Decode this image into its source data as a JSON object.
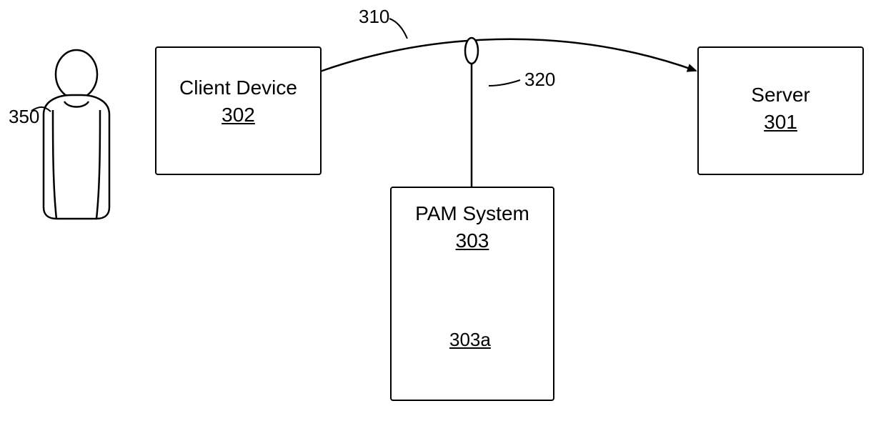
{
  "diagram": {
    "user_ref": "350",
    "client_device": {
      "title": "Client Device",
      "ref": "302"
    },
    "server": {
      "title": "Server",
      "ref": "301"
    },
    "pam_system": {
      "title": "PAM System",
      "ref": "303",
      "db_ref": "303a"
    },
    "top_arrow_ref": "310",
    "tap_ref": "320"
  }
}
